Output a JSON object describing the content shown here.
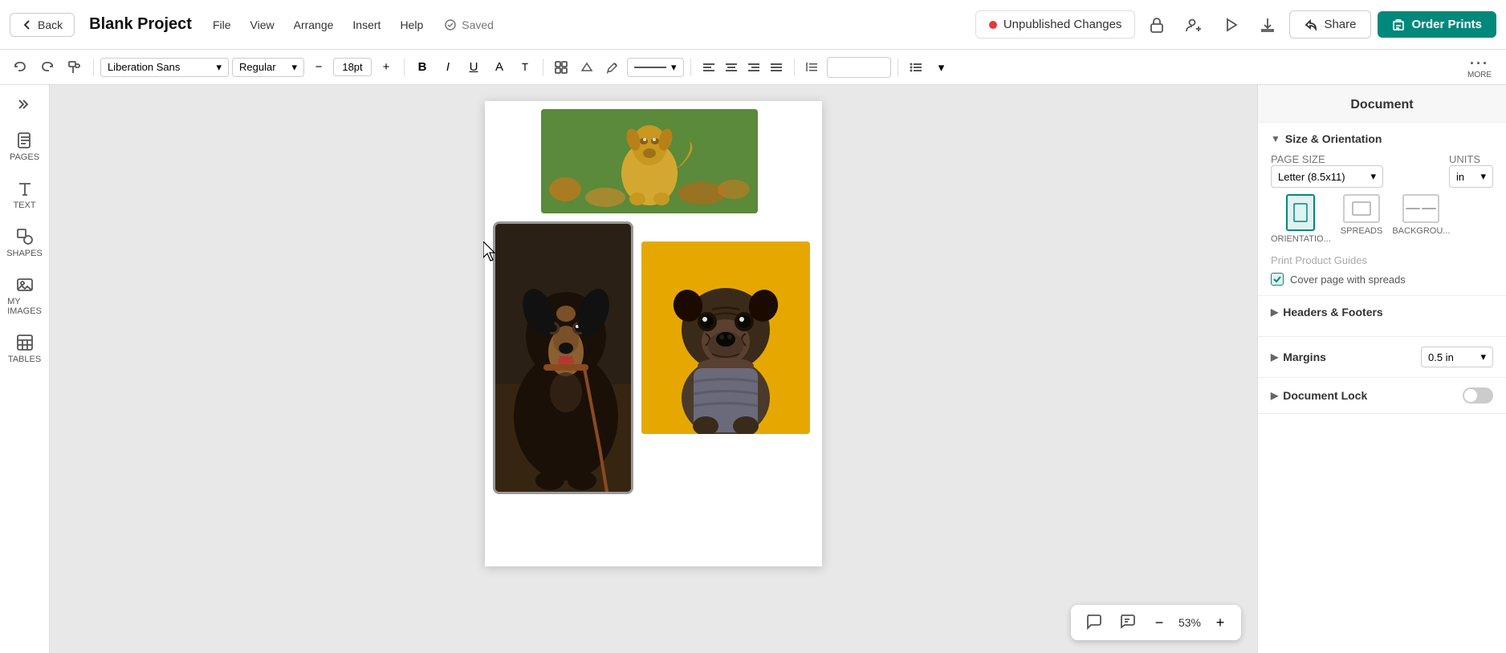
{
  "topbar": {
    "back_label": "Back",
    "project_title": "Blank Project",
    "file_label": "File",
    "view_label": "View",
    "arrange_label": "Arrange",
    "insert_label": "Insert",
    "help_label": "Help",
    "saved_label": "Saved",
    "unpublished_label": "Unpublished Changes",
    "share_label": "Share",
    "order_label": "Order Prints"
  },
  "toolbar": {
    "font_name": "Liberation Sans",
    "font_style": "Regular",
    "font_size": "18pt",
    "more_label": "MORE"
  },
  "sidebar": {
    "items": [
      {
        "id": "pages",
        "label": "PAGES"
      },
      {
        "id": "text",
        "label": "TEXT"
      },
      {
        "id": "shapes",
        "label": "SHAPES"
      },
      {
        "id": "my-images",
        "label": "MY IMAGES"
      },
      {
        "id": "tables",
        "label": "TABLES"
      }
    ]
  },
  "right_panel": {
    "title": "Document",
    "size_orientation": {
      "header": "Size & Orientation",
      "page_size_label": "PAGE SIZE",
      "page_size_value": "Letter (8.5x11)",
      "units_label": "UNITS",
      "units_value": "in",
      "orientations": [
        {
          "id": "portrait",
          "label": "ORIENTATIO...",
          "selected": true
        },
        {
          "id": "landscape",
          "label": "SPREADS",
          "selected": false
        },
        {
          "id": "spreads",
          "label": "BACKGROU...",
          "selected": false
        }
      ],
      "print_guides": "Print Product Guides",
      "cover_page_label": "Cover page with spreads",
      "cover_page_checked": true
    },
    "headers_footers": {
      "header": "Headers & Footers"
    },
    "margins": {
      "header": "Margins",
      "value": "0.5 in"
    },
    "document_lock": {
      "header": "Document Lock",
      "enabled": false
    }
  },
  "zoom": {
    "level": "53%",
    "minus_label": "−",
    "plus_label": "+"
  }
}
